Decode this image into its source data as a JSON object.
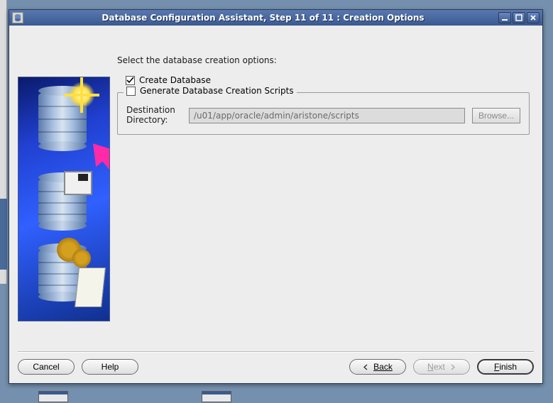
{
  "window": {
    "title": "Database Configuration Assistant, Step 11 of 11 : Creation Options"
  },
  "content": {
    "intro": "Select the database creation options:",
    "create_db_label": "Create Database",
    "create_db_checked": true,
    "gen_scripts_label": "Generate Database Creation Scripts",
    "gen_scripts_checked": false,
    "dest_label": "Destination\nDirectory:",
    "dest_value": "/u01/app/oracle/admin/aristone/scripts",
    "browse_label": "Browse..."
  },
  "buttons": {
    "cancel": "Cancel",
    "help": "Help",
    "back": "Back",
    "next": "Next",
    "finish": "Finish"
  }
}
